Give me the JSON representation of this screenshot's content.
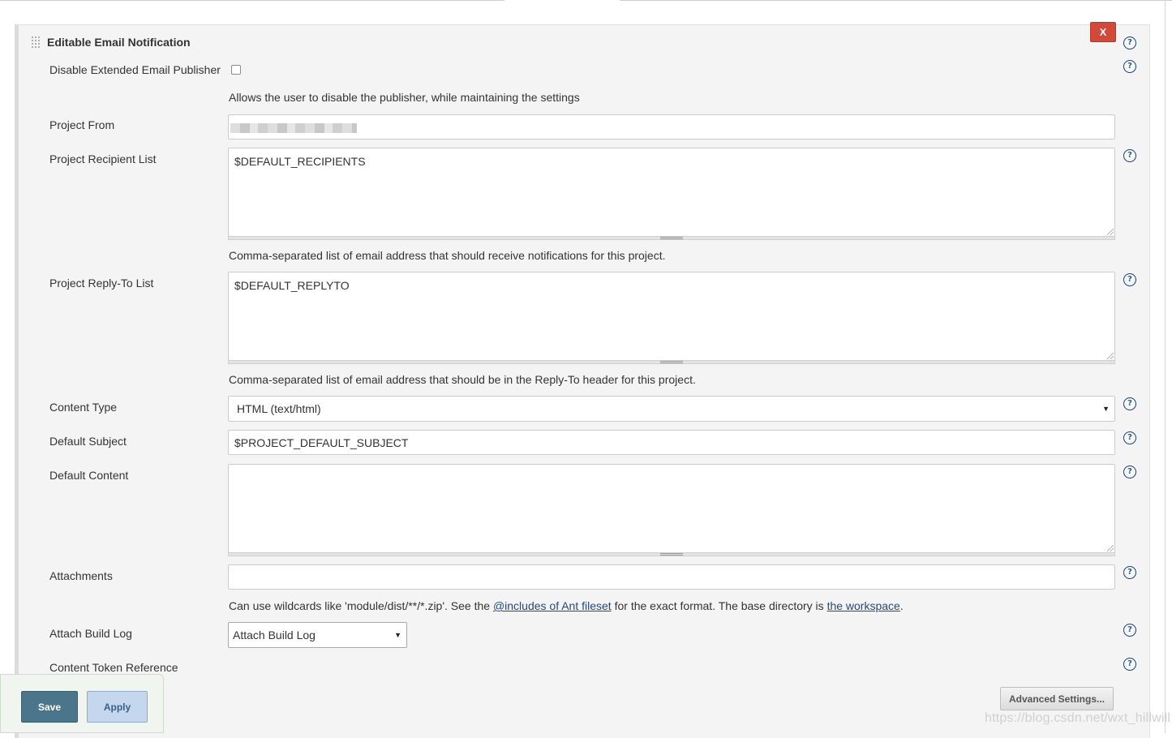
{
  "section": {
    "title": "Editable Email Notification",
    "close_label": "X"
  },
  "fields": {
    "disable_publisher": {
      "label": "Disable Extended Email Publisher",
      "checked": false,
      "description": "Allows the user to disable the publisher, while maintaining the settings"
    },
    "project_from": {
      "label": "Project From",
      "value": ""
    },
    "recipient_list": {
      "label": "Project Recipient List",
      "value": "$DEFAULT_RECIPIENTS",
      "description": "Comma-separated list of email address that should receive notifications for this project."
    },
    "reply_to_list": {
      "label": "Project Reply-To List",
      "value": "$DEFAULT_REPLYTO",
      "description": "Comma-separated list of email address that should be in the Reply-To header for this project."
    },
    "content_type": {
      "label": "Content Type",
      "selected": "HTML (text/html)"
    },
    "default_subject": {
      "label": "Default Subject",
      "value": "$PROJECT_DEFAULT_SUBJECT"
    },
    "default_content": {
      "label": "Default Content",
      "value": ""
    },
    "attachments": {
      "label": "Attachments",
      "value": "",
      "description_pre": "Can use wildcards like 'module/dist/**/*.zip'. See the ",
      "description_link1": "@includes of Ant fileset",
      "description_mid": " for the exact format. The base directory is ",
      "description_link2": "the workspace",
      "description_post": "."
    },
    "attach_build_log": {
      "label": "Attach Build Log",
      "selected": "Attach Build Log"
    },
    "content_token_reference": {
      "label": "Content Token Reference"
    }
  },
  "buttons": {
    "advanced_settings": "Advanced Settings...",
    "save": "Save",
    "apply": "Apply"
  },
  "icons": {
    "help": "help-icon",
    "grip": "drag-handle-icon"
  },
  "colors": {
    "close_button": "#d24939",
    "help_icon": "#2a5cab",
    "save_button": "#4b758b",
    "apply_button": "#c4d7ec",
    "link": "#204a87"
  },
  "watermark": "https://blog.csdn.net/wxt_hillwill"
}
